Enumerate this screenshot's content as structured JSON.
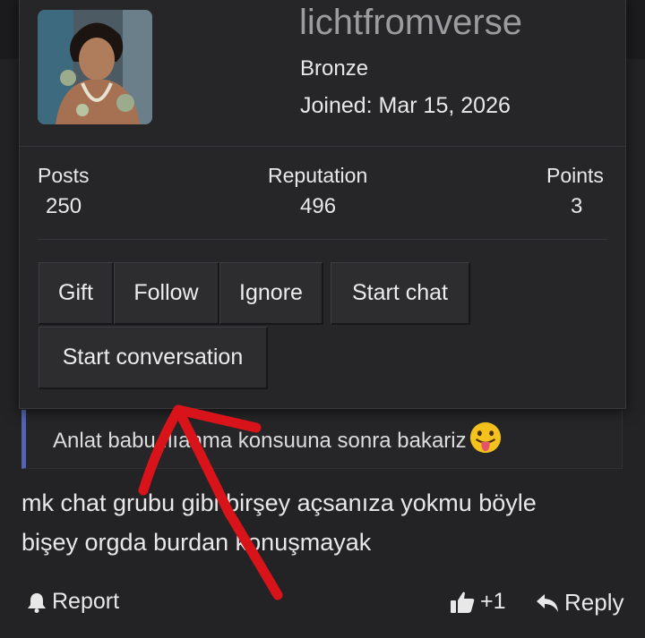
{
  "profile": {
    "username": "lichtfromverse",
    "rank": "Bronze",
    "joined": "Joined: Mar 15, 2026"
  },
  "stats": [
    {
      "label": "Posts",
      "value": "250"
    },
    {
      "label": "Reputation",
      "value": "496"
    },
    {
      "label": "Points",
      "value": "3"
    }
  ],
  "actions": {
    "gift": "Gift",
    "follow": "Follow",
    "ignore": "Ignore",
    "start_chat": "Start chat",
    "start_conversation": "Start conversation"
  },
  "quote": {
    "text": "Anlat babu  ılıanma konsuuna sonra bakariz",
    "emoji": "tongue-out-emoji"
  },
  "message": {
    "line1": "mk chat grubu gibi birşey açsanıza yokmu böyle",
    "line2": "bişey orgda burdan konuşmayak"
  },
  "footer": {
    "report": "Report",
    "like_count": "+1",
    "reply": "Reply"
  },
  "annotation": {
    "color": "#d8141a",
    "icon": "hand-drawn-arrow"
  },
  "colors": {
    "quote_border": "#5264b4",
    "username": "#9c9c9f"
  }
}
